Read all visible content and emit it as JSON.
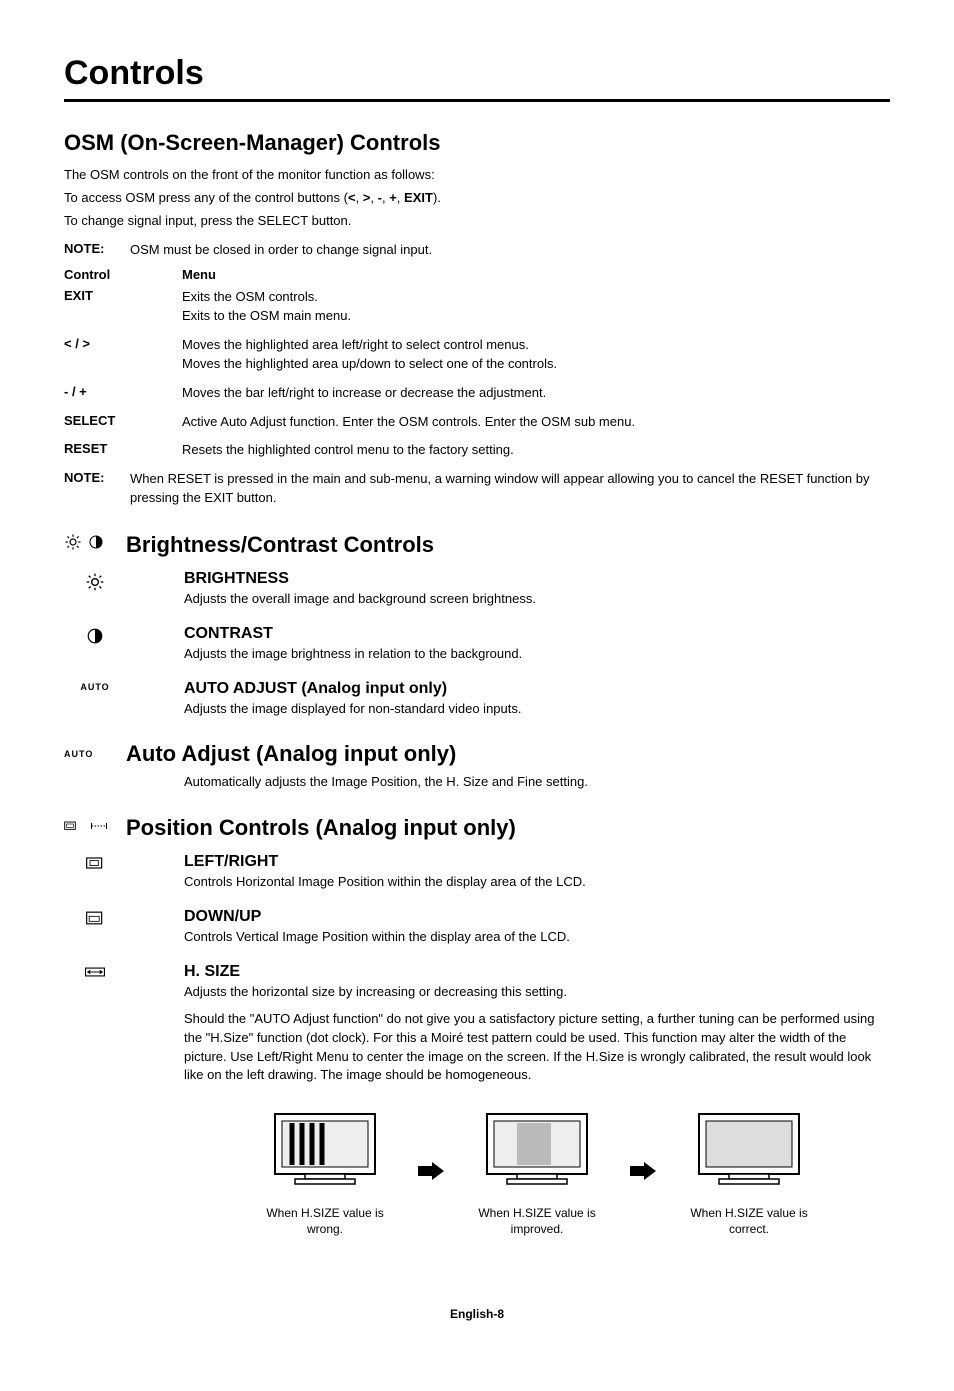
{
  "title": "Controls",
  "sec1": {
    "heading": "OSM (On-Screen-Manager) Controls",
    "p1": "The OSM controls on the front of the monitor function as follows:",
    "p2_pre": "To access OSM press any of the control buttons (",
    "p2_b1": "<",
    "p2_s1": ", ",
    "p2_b2": ">",
    "p2_s2": ", ",
    "p2_b3": "-",
    "p2_s3": ", ",
    "p2_b4": "+",
    "p2_s4": ", ",
    "p2_b5": "EXIT",
    "p2_post": ").",
    "p3": "To change signal input, press the SELECT button.",
    "note1_label": "NOTE:",
    "note1_body": "OSM must be closed in order to change signal input.",
    "head_c1": "Control",
    "head_c2": "Menu",
    "rows": [
      {
        "c1": "EXIT",
        "c2a": "Exits the OSM controls.",
        "c2b": "Exits to the OSM main menu."
      },
      {
        "c1": "< / >",
        "c2a": "Moves the highlighted area left/right to select control menus.",
        "c2b": "Moves the highlighted area up/down to select one of the controls."
      },
      {
        "c1": "- / +",
        "c2a": "Moves the bar left/right to increase or decrease the adjustment.",
        "c2b": ""
      },
      {
        "c1": "SELECT",
        "c2a": "Active Auto Adjust function. Enter the OSM controls. Enter the OSM sub menu.",
        "c2b": ""
      },
      {
        "c1": "RESET",
        "c2a": "Resets the highlighted control menu to the factory setting.",
        "c2b": ""
      }
    ],
    "note2_label": "NOTE:",
    "note2_body": "When RESET is pressed in the main and sub-menu, a warning window will appear allowing you to cancel the RESET function by pressing the EXIT button."
  },
  "sec2": {
    "heading": "Brightness/Contrast Controls",
    "items": [
      {
        "title": "BRIGHTNESS",
        "desc": "Adjusts the overall image and background screen brightness."
      },
      {
        "title": "CONTRAST",
        "desc": "Adjusts the image brightness in relation to the background."
      },
      {
        "title": "AUTO ADJUST (Analog input only)",
        "desc": "Adjusts the image displayed for non-standard video inputs."
      }
    ]
  },
  "sec3": {
    "heading": "Auto Adjust (Analog input only)",
    "body": "Automatically adjusts the Image Position, the H. Size and Fine setting."
  },
  "sec4": {
    "heading": "Position Controls (Analog input only)",
    "items": [
      {
        "title": "LEFT/RIGHT",
        "desc": "Controls Horizontal Image Position within the display area of the LCD."
      },
      {
        "title": "DOWN/UP",
        "desc": "Controls Vertical Image Position within the display area of the LCD."
      },
      {
        "title": "H. SIZE",
        "desc": "Adjusts the horizontal size by increasing or decreasing this setting.",
        "extra": "Should the \"AUTO Adjust function\" do not give you a satisfactory picture setting, a further tuning can be performed using the \"H.Size\" function (dot clock). For this a Moiré test pattern could be used. This function may alter the width of the picture. Use Left/Right Menu to center the image on the screen. If the H.Size is wrongly calibrated, the result would look like on the left drawing. The image should be homogeneous."
      }
    ],
    "figs": [
      "When H.SIZE value is wrong.",
      "When H.SIZE value is improved.",
      "When H.SIZE value is correct."
    ]
  },
  "footer": "English-8",
  "icons": {
    "auto": "AUTO"
  }
}
